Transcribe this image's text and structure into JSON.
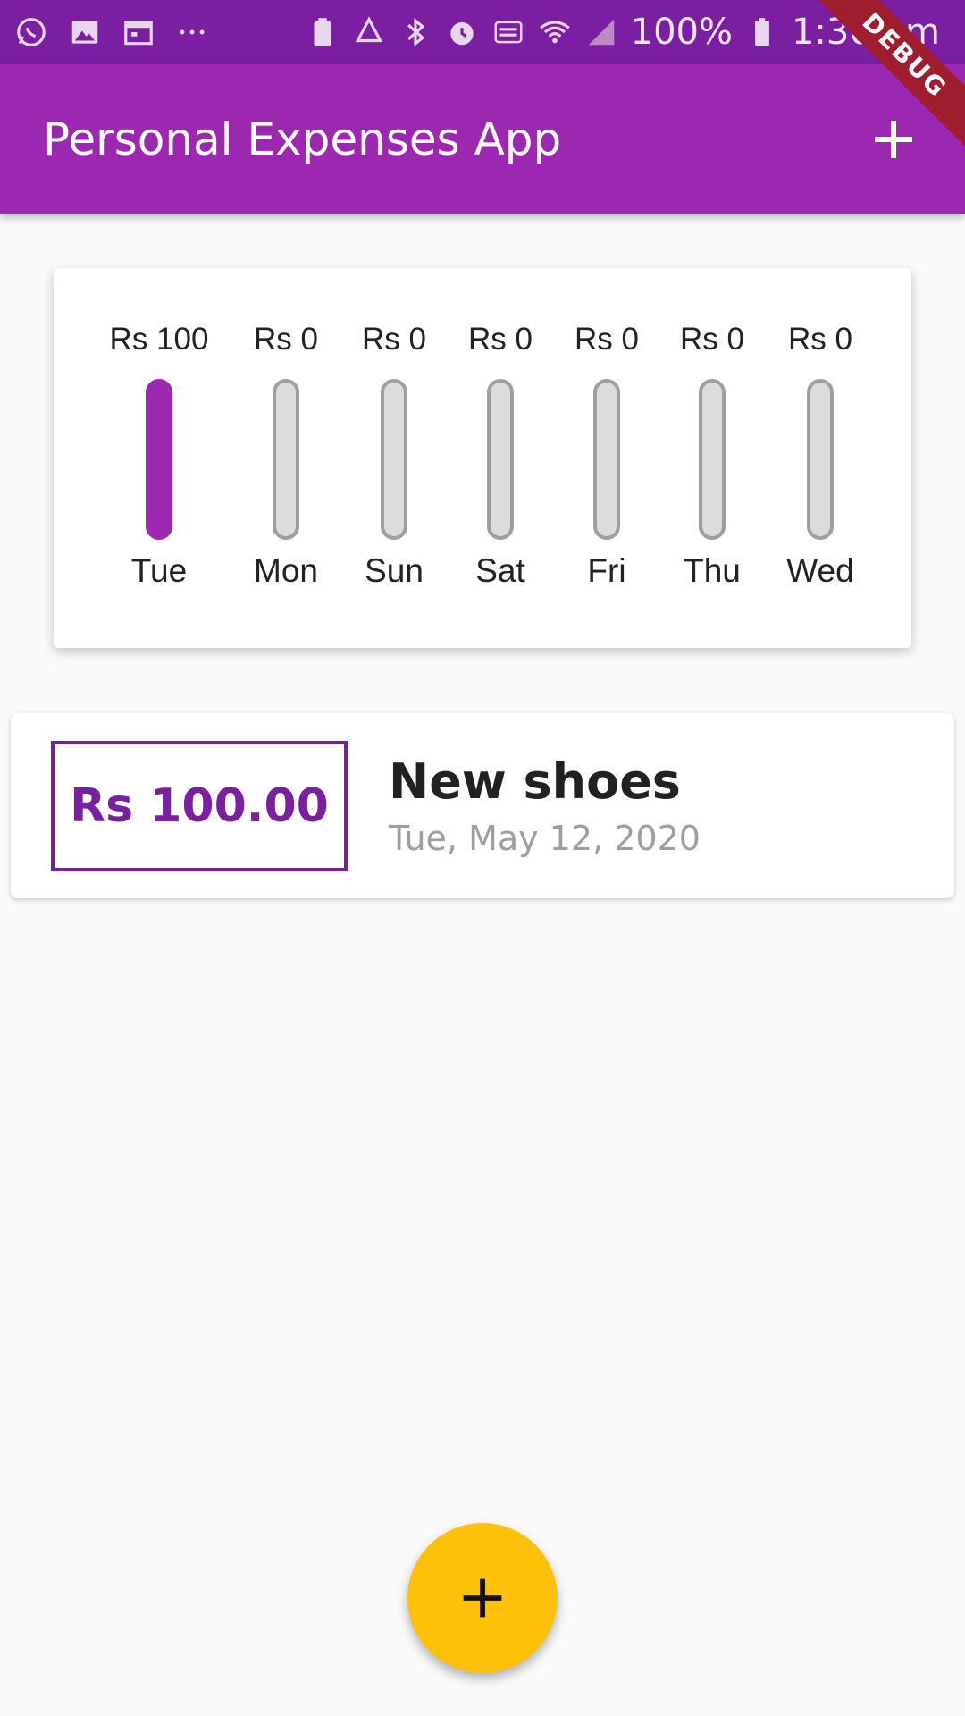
{
  "status_bar": {
    "battery": "100%",
    "time": "1:30 am",
    "icons": [
      "whatsapp-icon",
      "gallery-icon",
      "calendar-icon",
      "more-icon",
      "battery-saver-icon",
      "recycle-icon",
      "bluetooth-icon",
      "alarm-icon",
      "volte-icon",
      "wifi-icon",
      "signal-icon",
      "battery-icon"
    ]
  },
  "debug_banner": "DEBUG",
  "app_bar": {
    "title": "Personal Expenses App",
    "action_icon": "add-icon"
  },
  "chart": {
    "accent": "#9c27b0",
    "days": [
      {
        "amount": "Rs 100",
        "day": "Tue",
        "fill": 1.0
      },
      {
        "amount": "Rs 0",
        "day": "Mon",
        "fill": 0
      },
      {
        "amount": "Rs 0",
        "day": "Sun",
        "fill": 0
      },
      {
        "amount": "Rs 0",
        "day": "Sat",
        "fill": 0
      },
      {
        "amount": "Rs 0",
        "day": "Fri",
        "fill": 0
      },
      {
        "amount": "Rs 0",
        "day": "Thu",
        "fill": 0
      },
      {
        "amount": "Rs 0",
        "day": "Wed",
        "fill": 0
      }
    ]
  },
  "transactions": [
    {
      "amount": "Rs 100.00",
      "title": "New shoes",
      "date": "Tue, May 12, 2020"
    }
  ],
  "fab": {
    "icon": "add-icon",
    "color": "#ffc107"
  }
}
